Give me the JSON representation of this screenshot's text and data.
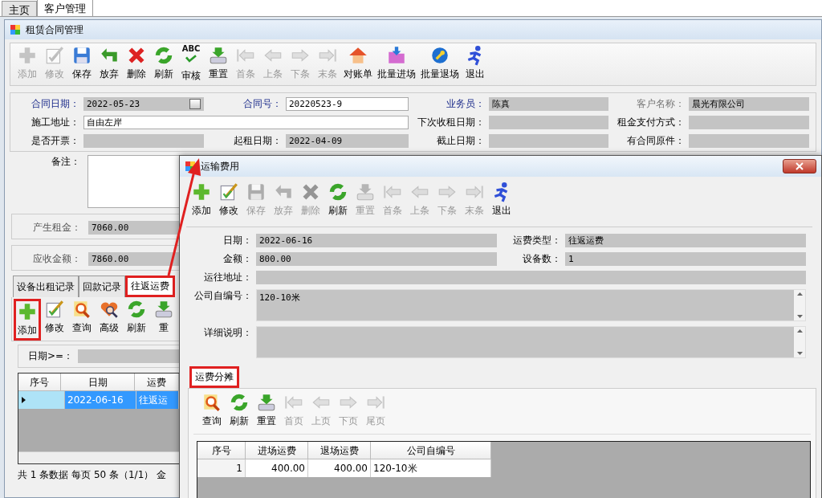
{
  "page_tabs": [
    {
      "label": "主页",
      "selected": false
    },
    {
      "label": "客户管理",
      "selected": true
    }
  ],
  "window": {
    "title": "租赁合同管理"
  },
  "toolbar": [
    {
      "label": "添加",
      "kind": "add",
      "disabled": true
    },
    {
      "label": "修改",
      "kind": "edit",
      "disabled": true
    },
    {
      "label": "保存",
      "kind": "save",
      "disabled": false
    },
    {
      "label": "放弃",
      "kind": "undo",
      "disabled": false
    },
    {
      "label": "删除",
      "kind": "delete",
      "disabled": false
    },
    {
      "label": "刷新",
      "kind": "refresh",
      "disabled": false
    },
    {
      "label": "审核",
      "kind": "audit",
      "icon_text": "ABC",
      "disabled": false
    },
    {
      "label": "重置",
      "kind": "reset",
      "disabled": false
    },
    {
      "label": "首条",
      "kind": "first",
      "disabled": true
    },
    {
      "label": "上条",
      "kind": "prev",
      "disabled": true
    },
    {
      "label": "下条",
      "kind": "next",
      "disabled": true
    },
    {
      "label": "末条",
      "kind": "last",
      "disabled": true
    },
    {
      "label": "对账单",
      "kind": "statement",
      "disabled": false
    },
    {
      "label": "批量进场",
      "kind": "batch-in",
      "disabled": false
    },
    {
      "label": "批量退场",
      "kind": "batch-out",
      "disabled": false
    },
    {
      "label": "退出",
      "kind": "exit",
      "disabled": false
    }
  ],
  "form": [
    {
      "label": "合同日期：",
      "required": true,
      "disabled": false,
      "kind": "date",
      "readonly": true,
      "value": "2022-05-23"
    },
    {
      "label": "合同号：",
      "required": true,
      "disabled": false,
      "kind": "text",
      "readonly": false,
      "value": "20220523-9"
    },
    {
      "label": "业务员：",
      "required": true,
      "disabled": false,
      "kind": "text",
      "readonly": true,
      "value": "陈真"
    },
    {
      "label": "客户名称：",
      "required": false,
      "disabled": true,
      "kind": "text",
      "readonly": true,
      "value": "晨光有限公司"
    },
    {
      "label": "施工地址：",
      "required": false,
      "disabled": false,
      "kind": "wide",
      "readonly": false,
      "value": "自由左岸"
    },
    {
      "label": "下次收租日期：",
      "required": false,
      "disabled": false,
      "kind": "text",
      "readonly": true
    },
    {
      "label": "租金支付方式：",
      "required": false,
      "disabled": false,
      "kind": "text",
      "readonly": true
    },
    {
      "label": "是否开票：",
      "required": false,
      "disabled": false,
      "kind": "text",
      "readonly": true
    },
    {
      "label": "起租日期：",
      "required": false,
      "disabled": false,
      "kind": "text",
      "readonly": true,
      "value": "2022-04-09"
    },
    {
      "label": "截止日期：",
      "required": false,
      "disabled": false,
      "kind": "text",
      "readonly": true
    },
    {
      "label": "有合同原件：",
      "required": false,
      "disabled": false,
      "kind": "text",
      "readonly": true
    }
  ],
  "remarks": {
    "label": "备注："
  },
  "totals": [
    {
      "label": "产生租金：",
      "value": "7060.00"
    },
    {
      "label": "应收金额：",
      "value": "7860.00"
    }
  ],
  "detail_tabs": [
    {
      "label": "设备出租记录",
      "selected": false,
      "highlighted": false
    },
    {
      "label": "回款记录",
      "selected": false,
      "highlighted": false
    },
    {
      "label": "往返运费",
      "selected": true,
      "highlighted": true
    }
  ],
  "detail_toolbar": [
    {
      "label": "添加",
      "kind": "add",
      "disabled": false,
      "highlighted": true
    },
    {
      "label": "修改",
      "kind": "edit",
      "disabled": false,
      "highlighted": false
    },
    {
      "label": "查询",
      "kind": "search",
      "disabled": false,
      "highlighted": false
    },
    {
      "label": "高级",
      "kind": "advanced",
      "disabled": false,
      "highlighted": false
    },
    {
      "label": "刷新",
      "kind": "refresh",
      "disabled": false,
      "highlighted": false
    },
    {
      "label": "重",
      "kind": "reset",
      "disabled": false,
      "highlighted": false
    }
  ],
  "filter": {
    "label": "日期>=："
  },
  "grid": {
    "columns": [
      "序号",
      "日期",
      "运费"
    ],
    "rows": [
      {
        "selected": true,
        "cells": [
          "",
          "2022-06-16",
          "往返运"
        ]
      }
    ]
  },
  "status_text": "共 1 条数据  每页 50 条（1/1）  金",
  "dialog": {
    "title": "运输费用",
    "toolbar": [
      {
        "label": "添加",
        "kind": "add",
        "disabled": false
      },
      {
        "label": "修改",
        "kind": "edit",
        "disabled": false
      },
      {
        "label": "保存",
        "kind": "save",
        "disabled": true
      },
      {
        "label": "放弃",
        "kind": "undo",
        "disabled": true
      },
      {
        "label": "删除",
        "kind": "delete",
        "disabled": true
      },
      {
        "label": "刷新",
        "kind": "refresh",
        "disabled": false
      },
      {
        "label": "重置",
        "kind": "reset",
        "disabled": true
      },
      {
        "label": "首条",
        "kind": "first",
        "disabled": true
      },
      {
        "label": "上条",
        "kind": "prev",
        "disabled": true
      },
      {
        "label": "下条",
        "kind": "next",
        "disabled": true
      },
      {
        "label": "末条",
        "kind": "last",
        "disabled": true
      },
      {
        "label": "退出",
        "kind": "exit",
        "disabled": false
      }
    ],
    "form": [
      {
        "label": "日期：",
        "kind": "text",
        "readonly": true,
        "value": "2022-06-16"
      },
      {
        "label": "运费类型：",
        "kind": "text",
        "readonly": true,
        "value": "往返运费"
      },
      {
        "label": "金额：",
        "kind": "text",
        "readonly": true,
        "value": "800.00"
      },
      {
        "label": "设备数：",
        "kind": "text",
        "readonly": true,
        "value": "1"
      },
      {
        "label": "运往地址：",
        "kind": "wide",
        "readonly": true
      },
      {
        "label": "公司自编号：",
        "kind": "memo",
        "readonly": true,
        "value": "120-10米"
      },
      {
        "label": "详细说明：",
        "kind": "memo",
        "readonly": true
      }
    ],
    "tabs": [
      {
        "label": "运费分摊",
        "selected": true,
        "highlighted": true
      }
    ],
    "sub_toolbar": [
      {
        "label": "查询",
        "kind": "search",
        "disabled": false
      },
      {
        "label": "刷新",
        "kind": "refresh",
        "disabled": false
      },
      {
        "label": "重置",
        "kind": "reset",
        "disabled": false
      },
      {
        "label": "首页",
        "kind": "first",
        "disabled": true
      },
      {
        "label": "上页",
        "kind": "prev",
        "disabled": true
      },
      {
        "label": "下页",
        "kind": "next",
        "disabled": true
      },
      {
        "label": "尾页",
        "kind": "last",
        "disabled": true
      }
    ],
    "grid": {
      "columns": [
        "序号",
        "进场运费",
        "退场运费",
        "公司自编号"
      ],
      "rows": [
        [
          "1",
          "400.00",
          "400.00",
          "120-10米"
        ]
      ]
    }
  },
  "annotation_arrow": true
}
